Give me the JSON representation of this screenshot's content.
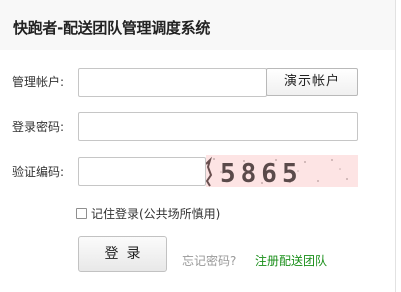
{
  "app": {
    "title": "快跑者-配送团队管理调度系统"
  },
  "form": {
    "account_label": "管理帐户:",
    "account_value": "",
    "account_placeholder": "",
    "demo_button_label": "演示帐户",
    "password_label": "登录密码:",
    "password_value": "",
    "captcha_label": "验证编码:",
    "captcha_value": "",
    "captcha_text": "5865",
    "remember_label": "记住登录(公共场所慎用)",
    "remember_checked": false,
    "login_button_label": "登录",
    "forgot_link_label": "忘记密码?",
    "register_link_label": "注册配送团队"
  },
  "colors": {
    "captcha_background": "#fde4e4",
    "captcha_text": "#5a4a4a",
    "register_link": "#1a8f1a",
    "forgot_link": "#999999"
  }
}
